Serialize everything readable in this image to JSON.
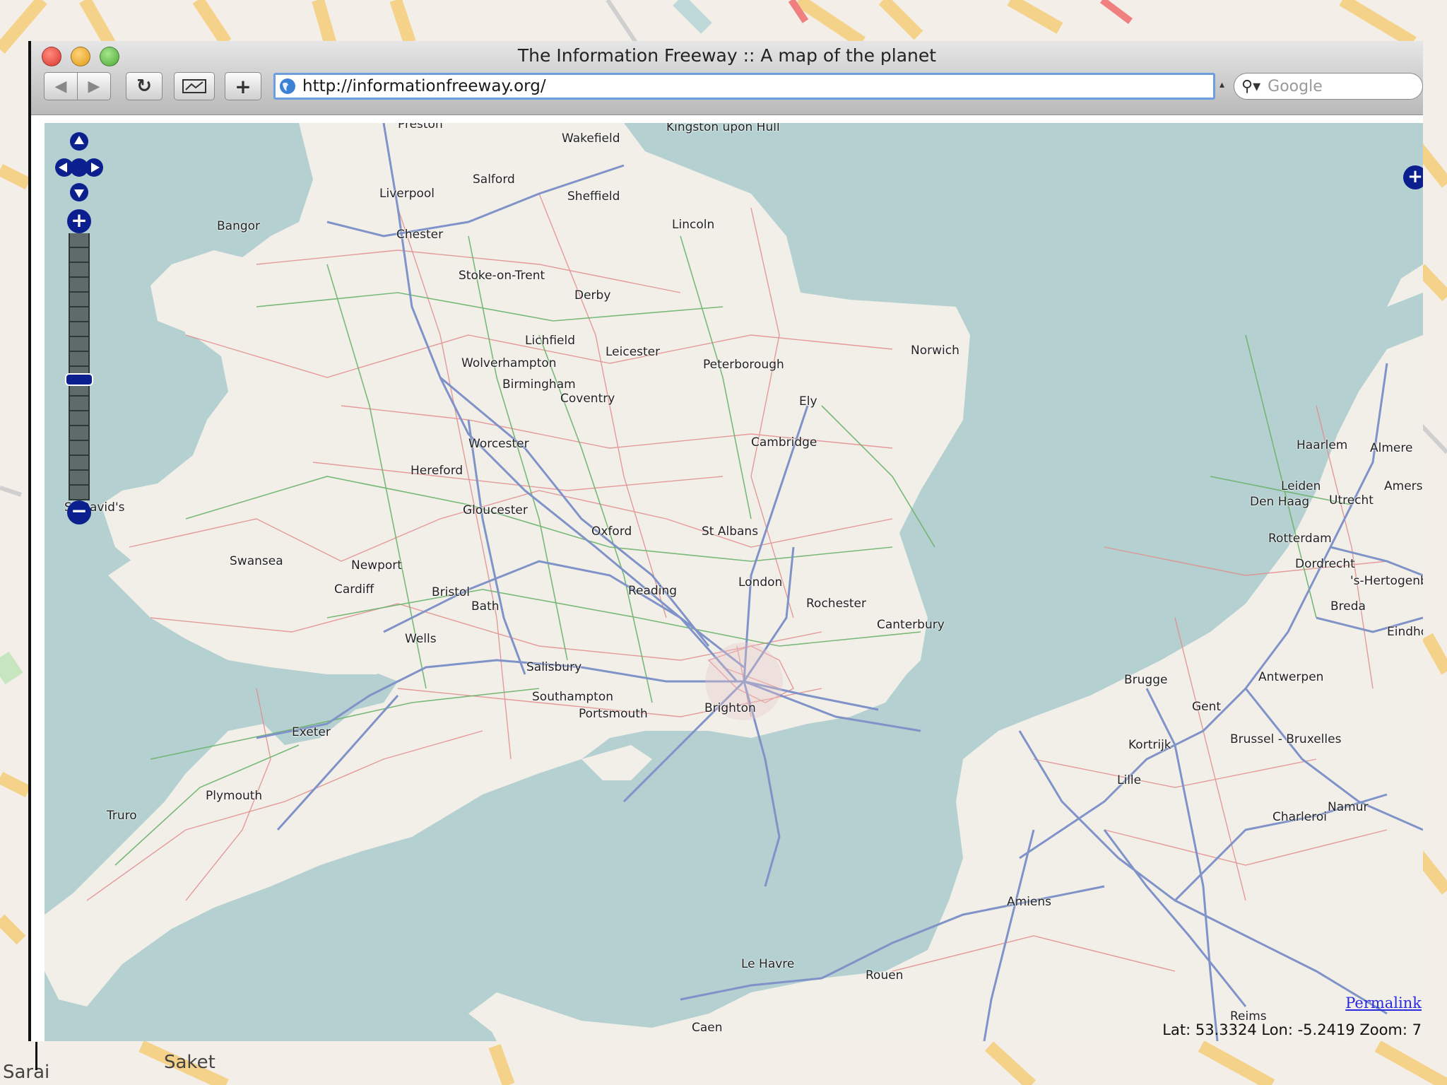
{
  "background": {
    "labels": [
      "Saket",
      "Sarai"
    ]
  },
  "window": {
    "title": "The Information Freeway :: A map of the planet",
    "url": "http://informationfreeway.org/",
    "search_placeholder": "Google",
    "buttons": {
      "back_icon": "back-arrow-icon",
      "forward_icon": "forward-arrow-icon",
      "reload_icon": "reload-icon",
      "snapback_icon": "snapback-icon",
      "add_icon": "plus-icon"
    }
  },
  "map": {
    "colors": {
      "sea": "#b5d0d0",
      "land": "#f2efe9",
      "motorway": "#7f93c8",
      "primary": "#6ab26a",
      "minor": "#e28b8b"
    },
    "cities": [
      "Preston",
      "Kingston upon Hull",
      "Wakefield",
      "Salford",
      "Liverpool",
      "Sheffield",
      "Bangor",
      "Chester",
      "Lincoln",
      "Stoke-on-Trent",
      "Derby",
      "Lichfield",
      "Leicester",
      "Wolverhampton",
      "Peterborough",
      "Norwich",
      "Birmingham",
      "Coventry",
      "Ely",
      "Worcester",
      "Cambridge",
      "Hereford",
      "St David's",
      "Gloucester",
      "Oxford",
      "St Albans",
      "Swansea",
      "Newport",
      "Cardiff",
      "Bristol",
      "Bath",
      "Reading",
      "London",
      "Rochester",
      "Canterbury",
      "Wells",
      "Salisbury",
      "Southampton",
      "Portsmouth",
      "Brighton",
      "Exeter",
      "Plymouth",
      "Truro",
      "Haarlem",
      "Almere",
      "Leiden",
      "Amersfoort",
      "Den Haag",
      "Utrecht",
      "Rotterdam",
      "Dordrecht",
      "'s-Hertogenbosch",
      "Breda",
      "Eindhoven",
      "Brugge",
      "Antwerpen",
      "Gent",
      "Kortrijk",
      "Brussel - Bruxelles",
      "Lille",
      "Namur",
      "Charleroi",
      "Amiens",
      "Rouen",
      "Le Havre",
      "Caen",
      "Reims"
    ],
    "permalink": "Permalink",
    "coords": "Lat: 53.3324 Lon: -5.2419 Zoom: 7",
    "zoom_level": 7,
    "zoom_levels_total": 18
  }
}
